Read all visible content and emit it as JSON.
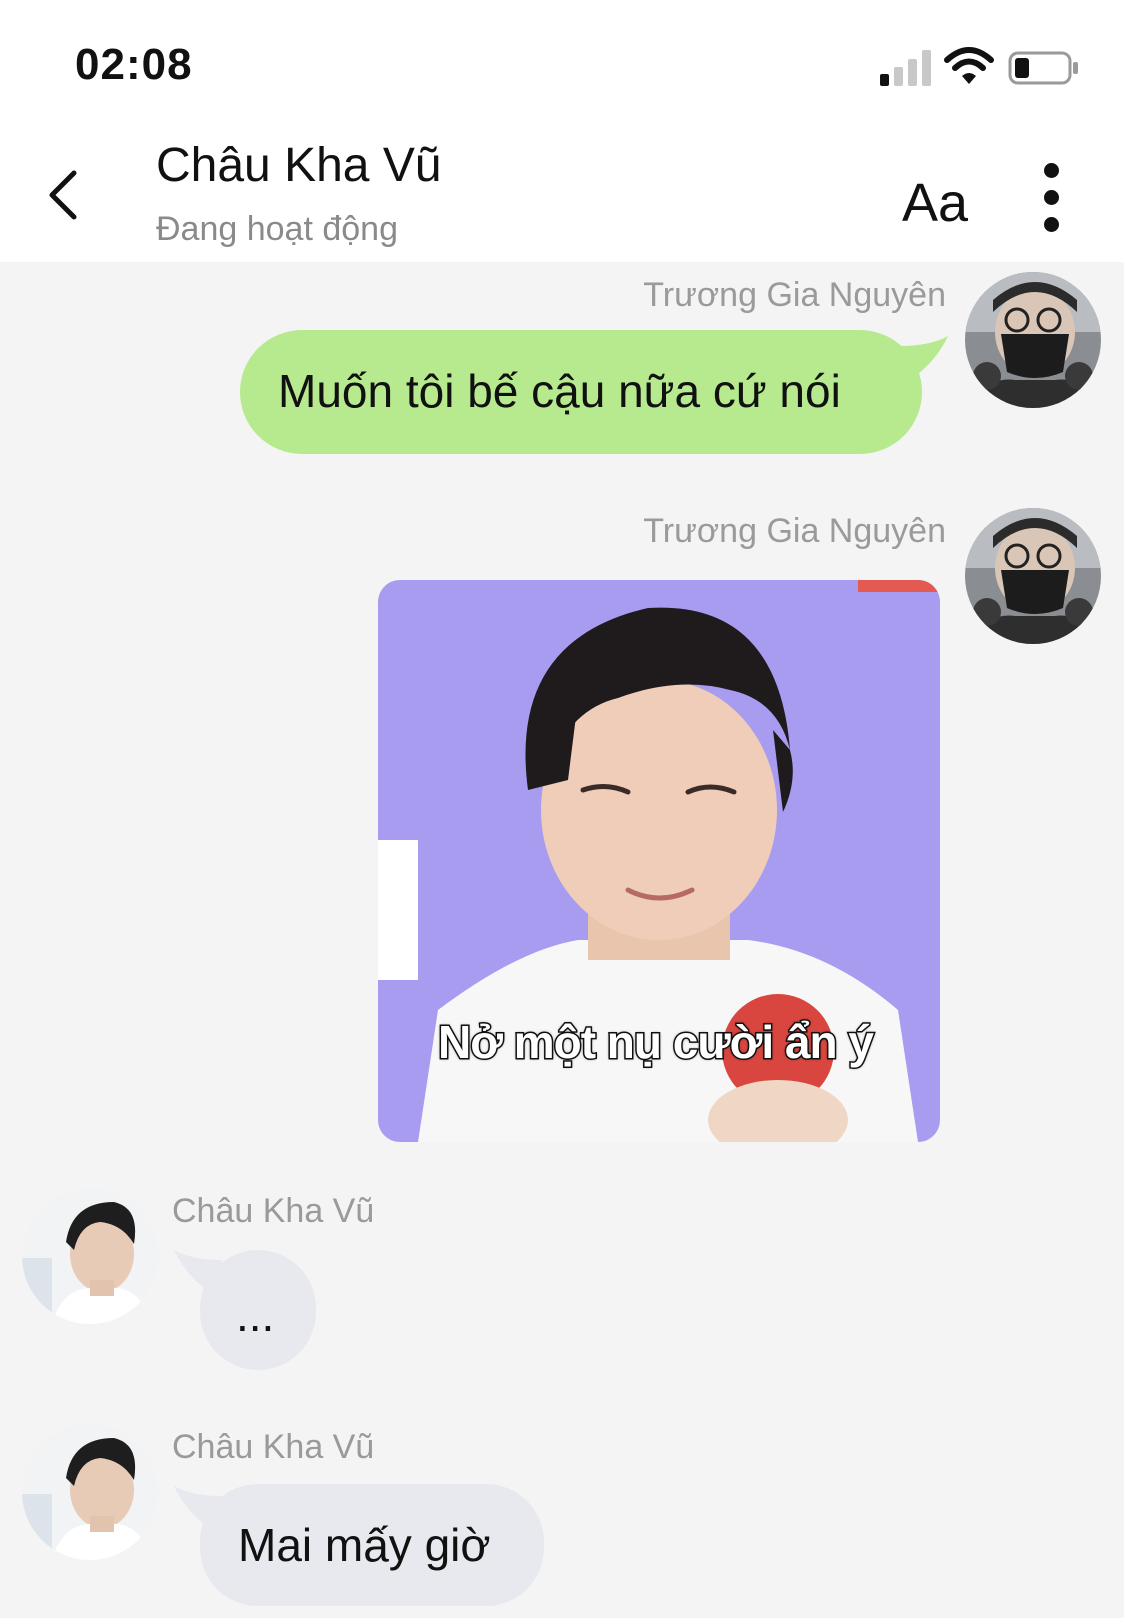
{
  "status_bar": {
    "time": "02:08"
  },
  "header": {
    "contact_name": "Châu Kha Vũ",
    "contact_status": "Đang hoạt động",
    "font_button_label": "Aa",
    "back_icon": "chevron-left-icon",
    "more_icon": "more-vertical-icon"
  },
  "messages": [
    {
      "sender": "Trương Gia Nguyên",
      "type": "text",
      "text": "Muốn tôi bế cậu nữa cứ nói"
    },
    {
      "sender": "Trương Gia Nguyên",
      "type": "sticker",
      "caption": "Nở một nụ cười ẩn ý"
    },
    {
      "sender": "Châu Kha Vũ",
      "type": "text",
      "text": "..."
    },
    {
      "sender": "Châu Kha Vũ",
      "type": "text",
      "text": "Mai mấy giờ"
    }
  ],
  "colors": {
    "outgoing_bubble": "#b7ea8e",
    "incoming_bubble": "#e7e9ee",
    "chat_background": "#f4f4f5",
    "sticker_background": "#a79cf0"
  }
}
